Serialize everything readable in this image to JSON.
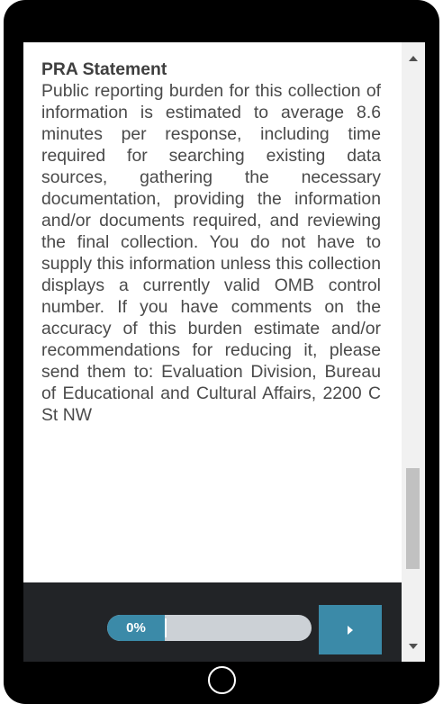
{
  "statement": {
    "title": "PRA Statement",
    "body": "Public reporting burden for this collection of information is estimated to average 8.6 minutes per response, including time required for searching existing data sources, gathering the necessary documentation, providing the information and/or documents required, and reviewing the final collection.  You do not have to supply this information unless this collection displays a currently valid OMB control number.  If you have comments on the accuracy of this burden estimate and/or recommendations for reducing it, please send them to: Evaluation Division, Bureau of Educational and Cultural Affairs, 2200 C St NW"
  },
  "progress": {
    "label": "0%",
    "value": 0
  },
  "icons": {
    "next": "play-arrow-icon",
    "scroll_up": "triangle-up-icon",
    "scroll_down": "triangle-down-icon",
    "home": "home-circle-icon"
  },
  "colors": {
    "accent": "#3b8aa8",
    "bottom_bar": "#222427",
    "progress_track": "#ccd1d6",
    "text": "#4a4a4a",
    "device": "#000000"
  }
}
